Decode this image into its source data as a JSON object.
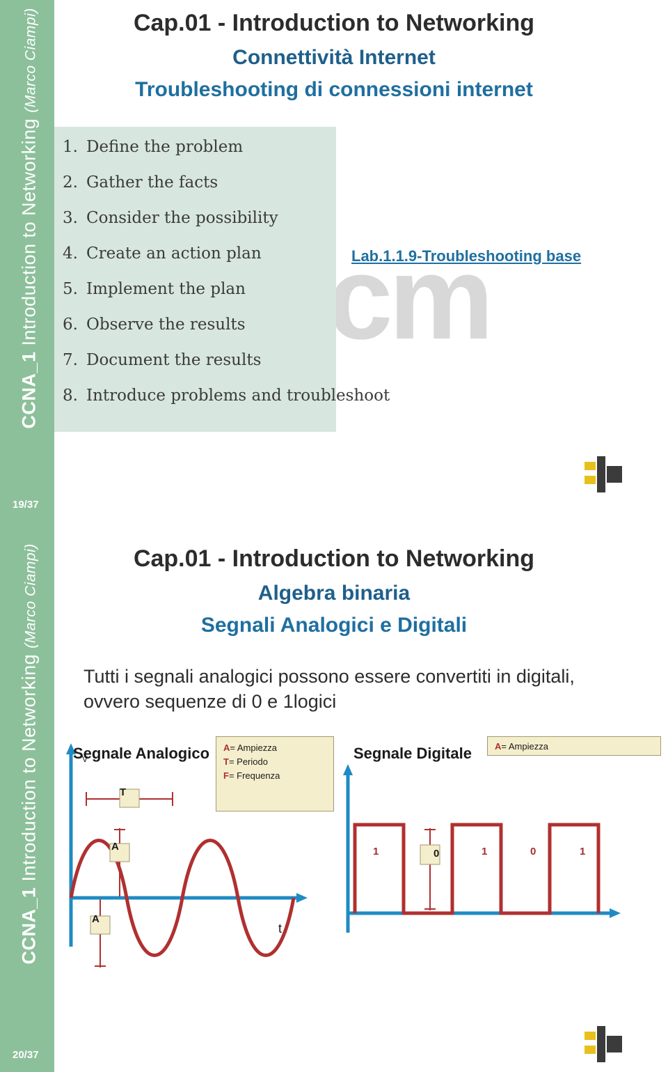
{
  "slides": [
    {
      "page_number": "19/37",
      "sidebar_label_bold": "CCNA_1",
      "sidebar_label_rest": " Introduction to Networking",
      "sidebar_label_author": "(Marco Ciampi)",
      "title_main": "Cap.01 - Introduction to Networking",
      "title_sub": "Connettività Internet",
      "title_sub2": "Troubleshooting di connessioni internet",
      "watermark": "cm",
      "link_text": "Lab.1.1.9-Troubleshooting base",
      "troubleshooting_steps": [
        {
          "num": "1.",
          "text": "Define the problem"
        },
        {
          "num": "2.",
          "text": "Gather the facts"
        },
        {
          "num": "3.",
          "text": "Consider the possibility"
        },
        {
          "num": "4.",
          "text": "Create an action plan"
        },
        {
          "num": "5.",
          "text": "Implement the plan"
        },
        {
          "num": "6.",
          "text": "Observe the results"
        },
        {
          "num": "7.",
          "text": "Document the results"
        },
        {
          "num": "8.",
          "text": "Introduce problems and troubleshoot"
        }
      ]
    },
    {
      "page_number": "20/37",
      "sidebar_label_bold": "CCNA_1",
      "sidebar_label_rest": " Introduction to Networking",
      "sidebar_label_author": "(Marco Ciampi)",
      "title_main": "Cap.01 - Introduction to Networking",
      "title_sub": "Algebra binaria",
      "title_sub2": "Segnali Analogici e Digitali",
      "body_text": "Tutti i segnali analogici possono essere convertiti in digitali, ovvero sequenze di 0 e 1logici",
      "analog": {
        "caption": "Segnale Analogico",
        "axis_y": "V",
        "axis_x": "t",
        "marker_period": "T",
        "marker_amp_top": "A",
        "marker_amp_bottom": "A",
        "legend": [
          {
            "key": "A",
            "desc": "= Ampiezza"
          },
          {
            "key": "T",
            "desc": "= Periodo"
          },
          {
            "key": "F",
            "desc": "= Frequenza"
          }
        ]
      },
      "digital": {
        "caption": "Segnale Digitale",
        "legend": [
          {
            "key": "A",
            "desc": "= Ampiezza"
          }
        ],
        "bits": [
          "1",
          "0",
          "1",
          "0",
          "1"
        ]
      }
    }
  ]
}
